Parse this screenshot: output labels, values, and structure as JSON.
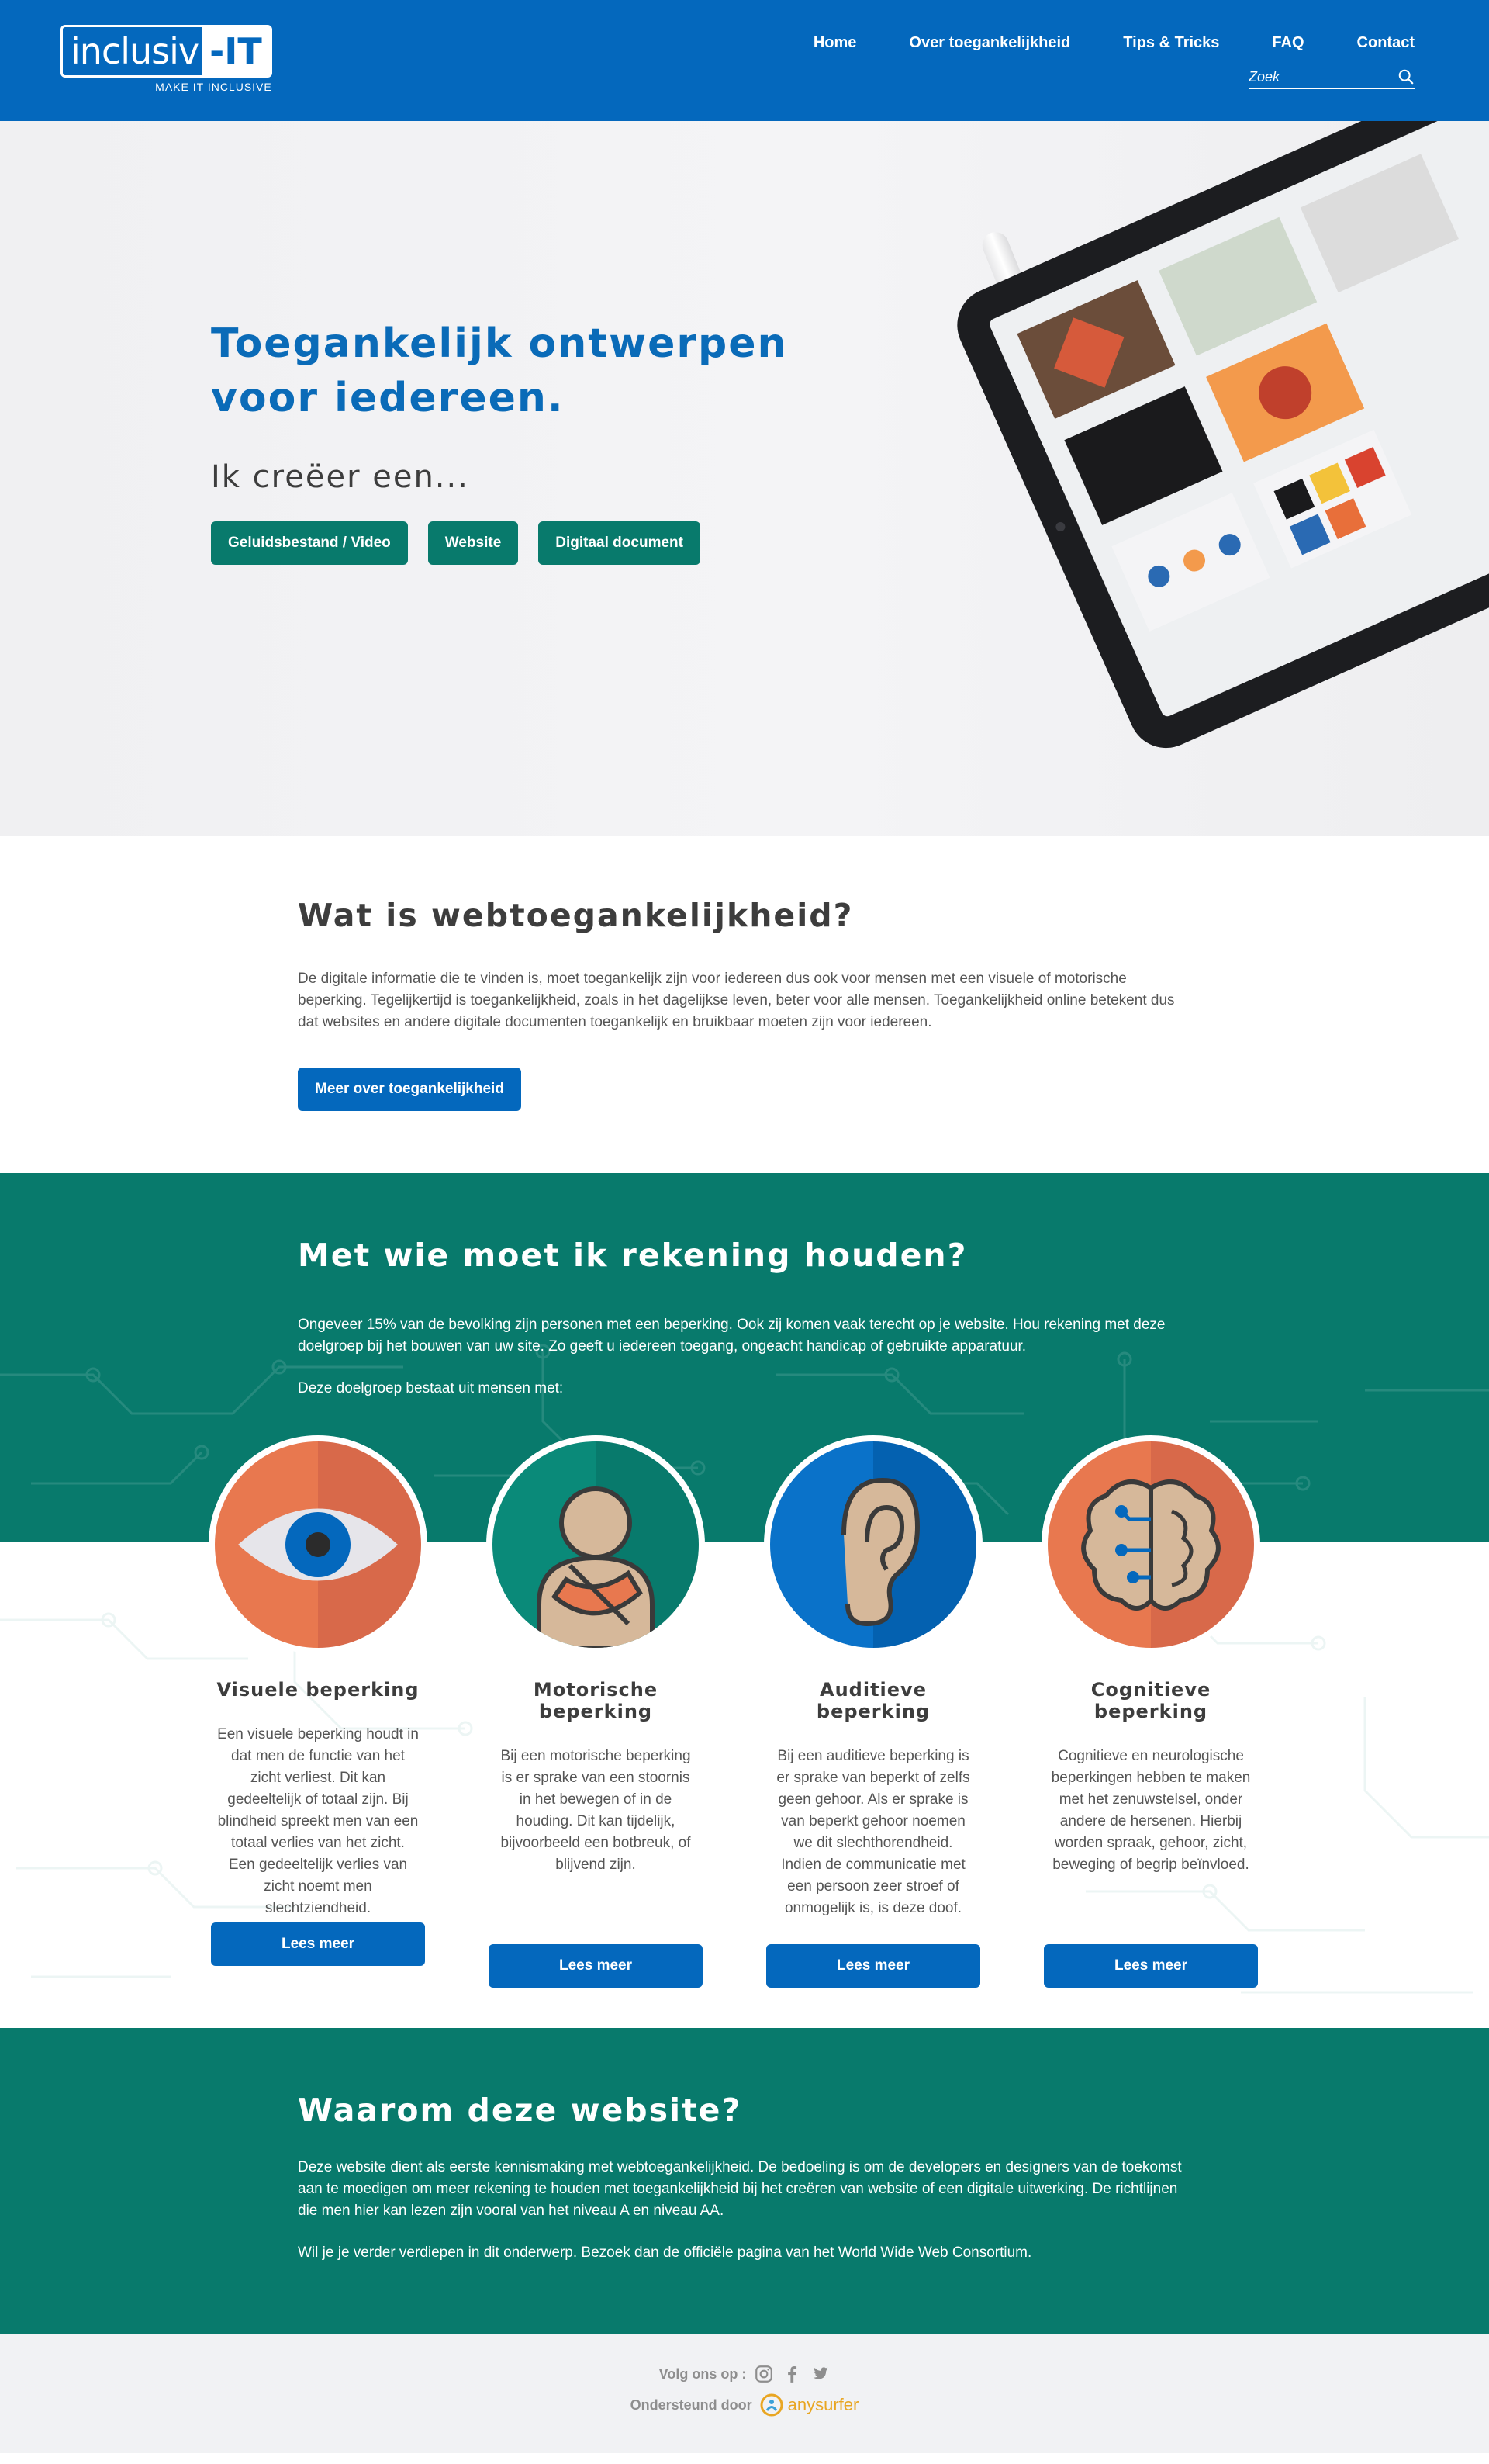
{
  "header": {
    "logo_text": "inclusiv",
    "logo_suffix": "-IT",
    "logo_tagline": "MAKE IT INCLUSIVE",
    "nav": [
      {
        "label": "Home"
      },
      {
        "label": "Over toegankelijkheid"
      },
      {
        "label": "Tips & Tricks"
      },
      {
        "label": "FAQ"
      },
      {
        "label": "Contact"
      }
    ],
    "search_placeholder": "Zoek"
  },
  "hero": {
    "title_line1": "Toegankelijk ontwerpen",
    "title_line2": "voor iedereen.",
    "subtitle": "Ik creëer een...",
    "buttons": [
      {
        "label": "Geluidsbestand / Video"
      },
      {
        "label": "Website"
      },
      {
        "label": "Digitaal document"
      }
    ]
  },
  "what": {
    "title": "Wat is webtoegankelijkheid?",
    "body": "De digitale informatie die te vinden is, moet toegankelijk zijn voor iedereen dus ook voor mensen met een visuele of motorische beperking. Tegelijkertijd is toegankelijkheid, zoals in het dagelijkse leven, beter voor alle mensen. Toegankelijkheid online betekent dus dat websites en andere digitale documenten toegankelijk en bruikbaar moeten  zijn voor iedereen.",
    "button": "Meer over toegankelijkheid"
  },
  "who": {
    "title": "Met wie moet ik rekening houden?",
    "intro": "Ongeveer 15% van de bevolking zijn personen met een beperking. Ook zij komen vaak terecht op je website. Hou rekening met deze doelgroep bij het bouwen van uw site. Zo geeft u iedereen toegang, ongeacht handicap of gebruikte apparatuur.",
    "intro2": "Deze doelgroep bestaat uit mensen met:",
    "cards": [
      {
        "title": "Visuele beperking",
        "body": "Een visuele beperking houdt in dat men de functie van het zicht verliest.  Dit kan gedeeltelijk of totaal zijn. Bij blindheid spreekt men van een totaal verlies van het zicht. Een gedeeltelijk verlies van zicht noemt men slechtziendheid.",
        "button": "Lees meer",
        "icon": "eye-icon"
      },
      {
        "title": "Motorische beperking",
        "body": "Bij een motorische beperking is er sprake van een stoornis in het bewegen of in de houding. Dit kan tijdelijk, bijvoorbeeld een botbreuk, of blijvend zijn.",
        "button": "Lees meer",
        "icon": "person-sling-icon"
      },
      {
        "title": "Auditieve beperking",
        "body": "Bij een auditieve beperking is er sprake van beperkt of zelfs geen gehoor. Als er sprake is van beperkt gehoor noemen we dit slechthorendheid. Indien de communicatie met een persoon zeer stroef of onmogelijk is, is deze doof.",
        "button": "Lees meer",
        "icon": "ear-icon"
      },
      {
        "title": "Cognitieve beperking",
        "body": "Cognitieve en neurologische beperkingen hebben te maken met het zenuwstelsel, onder andere de hersenen. Hierbij worden spraak, gehoor, zicht, beweging of begrip beïnvloed.",
        "button": "Lees meer",
        "icon": "brain-icon"
      }
    ]
  },
  "why": {
    "title": "Waarom deze website?",
    "body": "Deze website dient als eerste kennismaking met webtoegankelijkheid. De bedoeling is om de developers en designers van de toekomst aan te moedigen om meer rekening te houden met toegankelijkheid bij het creëren van website of een digitale uitwerking. De richtlijnen die men hier kan lezen zijn vooral van het niveau A en niveau AA.",
    "body2_prefix": "Wil je je verder verdiepen in dit onderwerp. Bezoek dan de officiële pagina van het ",
    "link": "World Wide Web Consortium",
    "body2_suffix": "."
  },
  "footer": {
    "follow": "Volg ons op :",
    "supported": "Ondersteund door",
    "sponsor": "anysurfer"
  },
  "colors": {
    "blue": "#0468bd",
    "green": "#087a6c",
    "orange": "#e8784f"
  }
}
